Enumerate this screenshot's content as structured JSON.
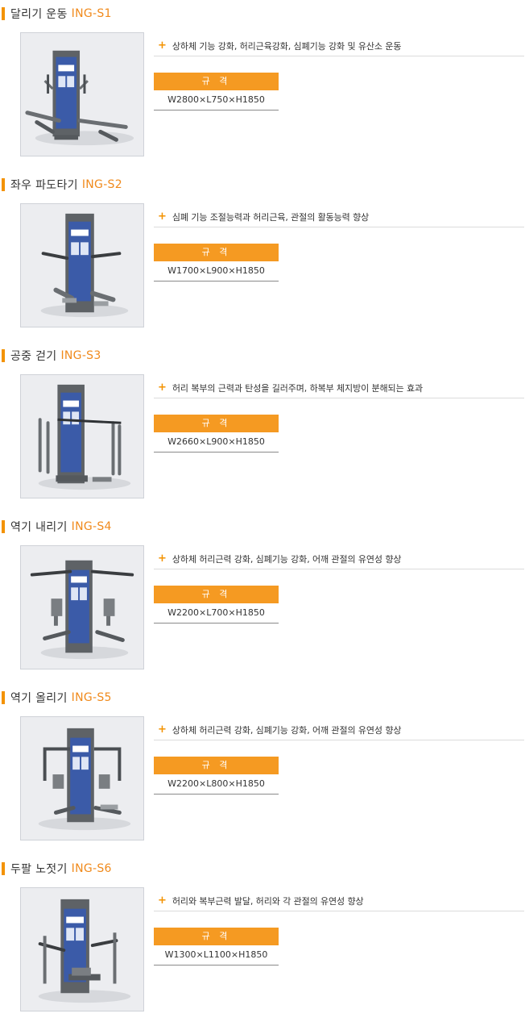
{
  "products": [
    {
      "name": "달리기 운동",
      "code": "ING-S1",
      "feature": "상하체 기능 강화, 허리근육강화, 심폐기능 강화 및 유산소 운동",
      "spec_label": "규 격",
      "spec_value": "W2800×L750×H1850"
    },
    {
      "name": "좌우 파도타기",
      "code": "ING-S2",
      "feature": "심폐 기능 조절능력과 허리근육, 관절의 활동능력 향상",
      "spec_label": "규 격",
      "spec_value": "W1700×L900×H1850"
    },
    {
      "name": "공중 걷기",
      "code": "ING-S3",
      "feature": "허리 복부의 근력과 탄성을 길러주며, 하복부 체지방이 분해되는 효과",
      "spec_label": "규 격",
      "spec_value": "W2660×L900×H1850"
    },
    {
      "name": "역기 내리기",
      "code": "ING-S4",
      "feature": "상하체 허리근력 강화, 심폐기능 강화, 어깨 관절의 유연성 향상",
      "spec_label": "규 격",
      "spec_value": "W2200×L700×H1850"
    },
    {
      "name": "역기 올리기",
      "code": "ING-S5",
      "feature": "상하체 허리근력 강화, 심폐기능 강화, 어깨 관절의 유연성 향상",
      "spec_label": "규 격",
      "spec_value": "W2200×L800×H1850"
    },
    {
      "name": "두팔 노젓기",
      "code": "ING-S6",
      "feature": "허리와 복부근력 발달, 허리와 각 관절의 유연성 향상",
      "spec_label": "규 격",
      "spec_value": "W1300×L1100×H1850"
    }
  ],
  "colors": {
    "accent": "#f39200",
    "spec_header": "#f59a22",
    "panel_blue": "#3b5ba8",
    "frame_gray": "#5e6266"
  },
  "icons": {
    "bullet": "plus-icon"
  }
}
